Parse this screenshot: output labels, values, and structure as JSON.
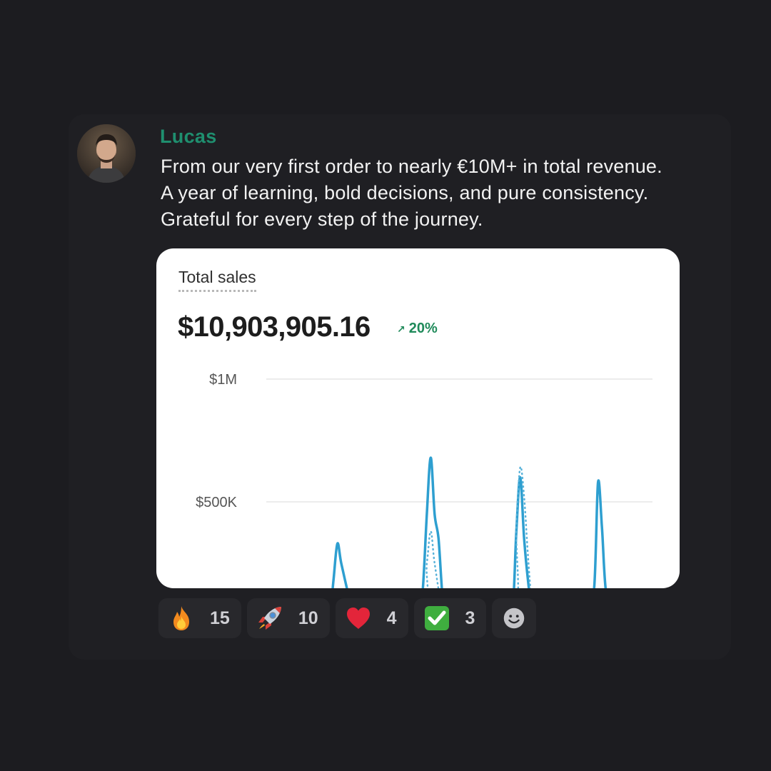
{
  "message": {
    "author": "Lucas",
    "lines": [
      "From our very first order to nearly €10M+ in total revenue.",
      "A year of learning, bold decisions, and pure consistency.",
      "Grateful for every step of the journey."
    ]
  },
  "sales_card": {
    "label": "Total sales",
    "total": "$10,903,905.16",
    "growth": "20%",
    "growth_color": "#1f8a5a"
  },
  "chart_data": {
    "type": "line",
    "y_ticks": [
      "$1M",
      "$500K"
    ],
    "ylim": [
      0,
      1000000
    ],
    "grid": true,
    "series": [
      {
        "style": "solid",
        "color": "#2e9fd0",
        "points": [
          [
            0,
            0
          ],
          [
            0.04,
            0
          ],
          [
            0.06,
            20000
          ],
          [
            0.08,
            0
          ],
          [
            0.15,
            0
          ],
          [
            0.17,
            40000
          ],
          [
            0.18,
            180000
          ],
          [
            0.19,
            330000
          ],
          [
            0.2,
            250000
          ],
          [
            0.22,
            110000
          ],
          [
            0.23,
            40000
          ],
          [
            0.24,
            0
          ],
          [
            0.27,
            0
          ],
          [
            0.28,
            40000
          ],
          [
            0.3,
            20000
          ],
          [
            0.32,
            20000
          ],
          [
            0.33,
            40000
          ],
          [
            0.35,
            20000
          ],
          [
            0.38,
            0
          ],
          [
            0.4,
            20000
          ],
          [
            0.41,
            150000
          ],
          [
            0.42,
            450000
          ],
          [
            0.43,
            680000
          ],
          [
            0.44,
            450000
          ],
          [
            0.45,
            350000
          ],
          [
            0.46,
            120000
          ],
          [
            0.47,
            20000
          ],
          [
            0.48,
            0
          ],
          [
            0.5,
            0
          ],
          [
            0.52,
            50000
          ],
          [
            0.53,
            20000
          ],
          [
            0.54,
            0
          ],
          [
            0.57,
            20000
          ],
          [
            0.58,
            80000
          ],
          [
            0.59,
            60000
          ],
          [
            0.6,
            20000
          ],
          [
            0.61,
            0
          ],
          [
            0.62,
            0
          ],
          [
            0.64,
            50000
          ],
          [
            0.65,
            380000
          ],
          [
            0.66,
            600000
          ],
          [
            0.67,
            350000
          ],
          [
            0.68,
            180000
          ],
          [
            0.69,
            60000
          ],
          [
            0.7,
            0
          ],
          [
            0.74,
            0
          ],
          [
            0.75,
            20000
          ],
          [
            0.78,
            40000
          ],
          [
            0.8,
            50000
          ],
          [
            0.82,
            40000
          ],
          [
            0.83,
            20000
          ],
          [
            0.85,
            150000
          ],
          [
            0.86,
            580000
          ],
          [
            0.87,
            400000
          ],
          [
            0.88,
            140000
          ],
          [
            0.9,
            0
          ],
          [
            1,
            0
          ]
        ]
      },
      {
        "style": "dotted",
        "color": "#5ab3da",
        "points": [
          [
            0,
            0
          ],
          [
            0.14,
            0
          ],
          [
            0.16,
            20000
          ],
          [
            0.18,
            0
          ],
          [
            0.4,
            0
          ],
          [
            0.42,
            250000
          ],
          [
            0.43,
            380000
          ],
          [
            0.44,
            250000
          ],
          [
            0.46,
            60000
          ],
          [
            0.48,
            0
          ],
          [
            0.64,
            0
          ],
          [
            0.65,
            400000
          ],
          [
            0.66,
            640000
          ],
          [
            0.67,
            520000
          ],
          [
            0.68,
            280000
          ],
          [
            0.69,
            80000
          ],
          [
            0.7,
            0
          ],
          [
            0.72,
            0
          ],
          [
            0.74,
            40000
          ],
          [
            0.76,
            20000
          ],
          [
            0.78,
            60000
          ],
          [
            0.79,
            80000
          ],
          [
            0.8,
            40000
          ],
          [
            0.82,
            30000
          ],
          [
            0.84,
            0
          ],
          [
            0.92,
            0
          ],
          [
            0.93,
            20000
          ],
          [
            0.95,
            30000
          ],
          [
            0.97,
            50000
          ],
          [
            0.99,
            30000
          ],
          [
            1,
            0
          ]
        ]
      }
    ]
  },
  "reactions": [
    {
      "icon": "fire-icon",
      "count": "15"
    },
    {
      "icon": "rocket-icon",
      "count": "10"
    },
    {
      "icon": "heart-icon",
      "count": "4"
    },
    {
      "icon": "check-icon",
      "count": "3"
    },
    {
      "icon": "add-reaction-icon"
    }
  ]
}
